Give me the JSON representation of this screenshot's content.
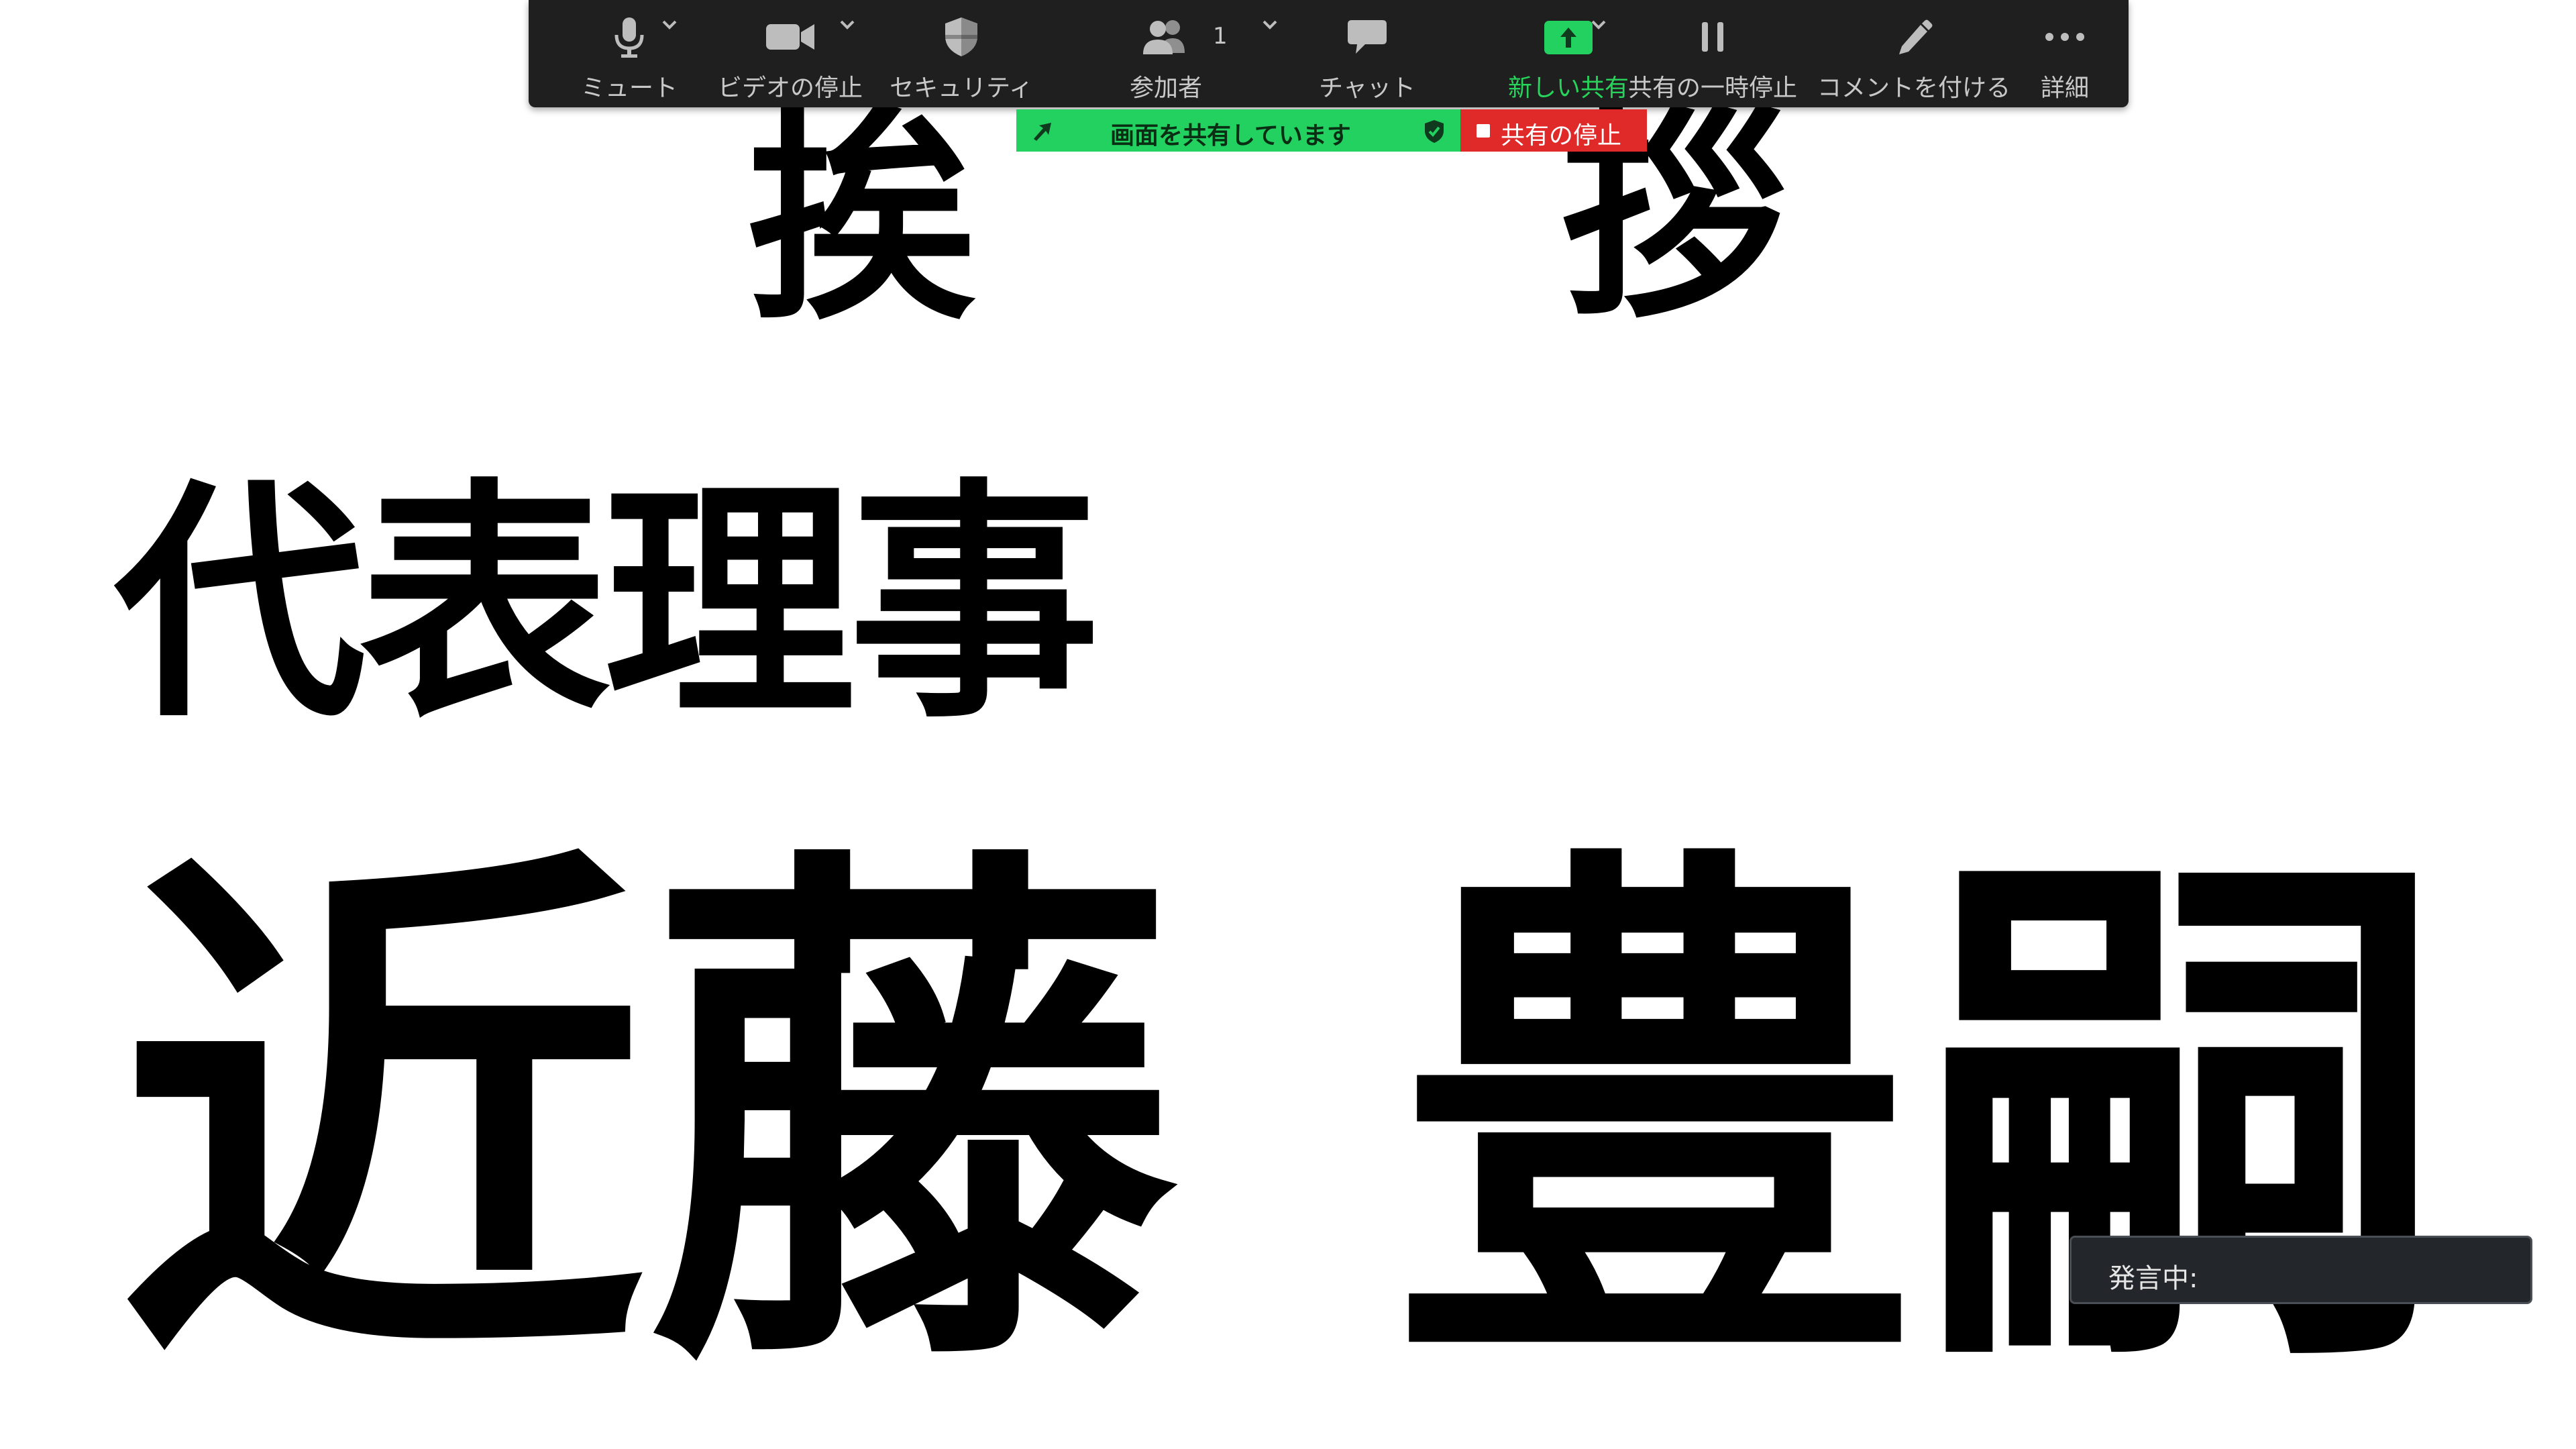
{
  "slide": {
    "greeting_left": "挨",
    "greeting_right": "拶",
    "role": "代表理事",
    "name_family": "近藤",
    "name_given": "豊嗣"
  },
  "toolbar": {
    "mute_label": "ミュート",
    "video_label": "ビデオの停止",
    "security_label": "セキュリティ",
    "participants_label": "参加者",
    "participants_count": "1",
    "chat_label": "チャット",
    "new_share_label": "新しい共有",
    "pause_share_label": "共有の一時停止",
    "annotate_label": "コメントを付ける",
    "more_label": "詳細"
  },
  "share_banner": {
    "text": "画面を共有しています",
    "stop_label": "共有の停止"
  },
  "speaking": {
    "text": "発言中:"
  },
  "colors": {
    "toolbar_bg": "#1f1f1f",
    "share_green": "#23d160",
    "stop_red": "#e02a2a",
    "label_gray": "#c8c8c8",
    "active_green": "#27d35a"
  },
  "icons": {
    "mute": "microphone-icon",
    "video": "video-camera-icon",
    "security": "shield-icon",
    "participants": "people-icon",
    "chat": "speech-bubble-icon",
    "new_share": "share-arrow-up-icon",
    "pause_share": "pause-icon",
    "annotate": "pencil-icon",
    "more": "ellipsis-icon"
  }
}
